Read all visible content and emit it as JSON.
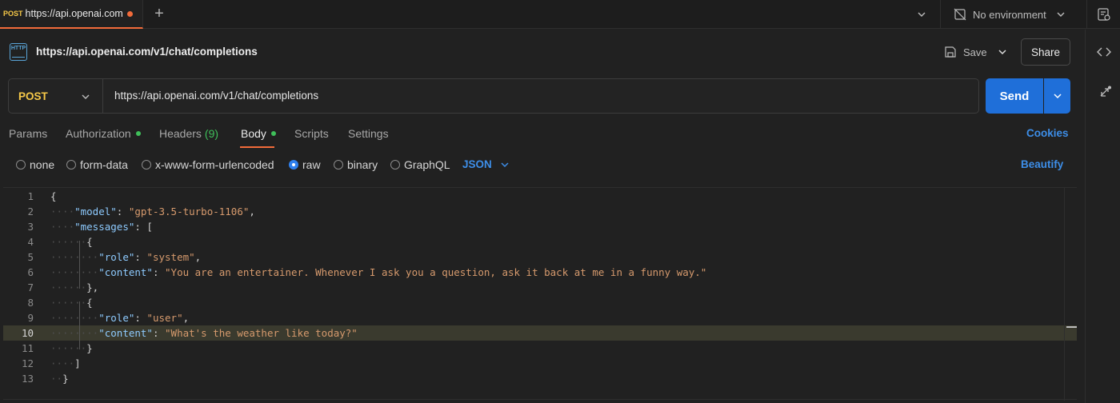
{
  "tab": {
    "method": "POST",
    "title": "https://api.openai.com"
  },
  "environment": {
    "label": "No environment"
  },
  "request": {
    "title": "https://api.openai.com/v1/chat/completions",
    "save_label": "Save",
    "share_label": "Share",
    "method": "POST",
    "url": "https://api.openai.com/v1/chat/completions",
    "send_label": "Send"
  },
  "request_tabs": {
    "params": "Params",
    "authorization": "Authorization",
    "headers": "Headers",
    "headers_count": "(9)",
    "body": "Body",
    "scripts": "Scripts",
    "settings": "Settings",
    "cookies": "Cookies"
  },
  "body_types": {
    "none": "none",
    "form_data": "form-data",
    "urlencoded": "x-www-form-urlencoded",
    "raw": "raw",
    "binary": "binary",
    "graphql": "GraphQL",
    "format": "JSON",
    "beautify": "Beautify",
    "selected": "raw"
  },
  "editor": {
    "highlighted_line": 10,
    "lines": [
      {
        "n": "1"
      },
      {
        "n": "2"
      },
      {
        "n": "3"
      },
      {
        "n": "4"
      },
      {
        "n": "5"
      },
      {
        "n": "6"
      },
      {
        "n": "7"
      },
      {
        "n": "8"
      },
      {
        "n": "9"
      },
      {
        "n": "10"
      },
      {
        "n": "11"
      },
      {
        "n": "12"
      },
      {
        "n": "13"
      }
    ],
    "keys": {
      "model": "\"model\"",
      "messages": "\"messages\"",
      "role": "\"role\"",
      "content": "\"content\""
    },
    "values": {
      "model": "\"gpt-3.5-turbo-1106\"",
      "role1": "\"system\"",
      "content1": "\"You are an entertainer. Whenever I ask you a question, ask it back at me in a funny way.\"",
      "role2": "\"user\"",
      "content2": "\"What's the weather like today?\""
    }
  },
  "colors": {
    "accent": "#f26b3a",
    "primary": "#1f6fd9",
    "method": "#f7c948",
    "ok": "#3fbf5a",
    "link": "#3d8ee8"
  }
}
